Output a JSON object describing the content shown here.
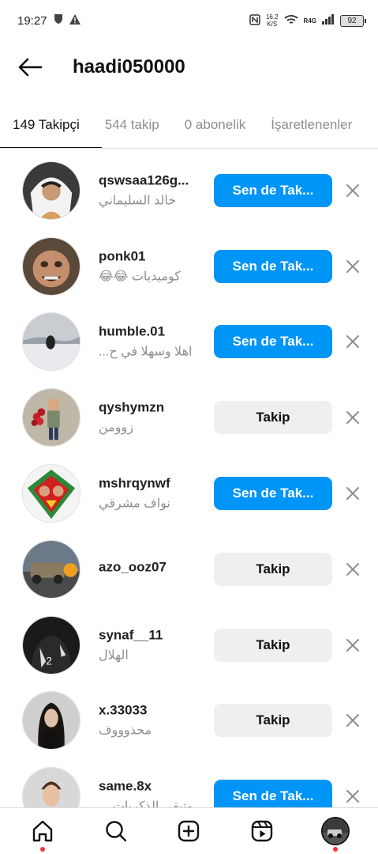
{
  "status_bar": {
    "time": "19:27",
    "net_speed_value": "16,2",
    "net_speed_unit": "K/S",
    "network": "R4G",
    "battery": "92"
  },
  "header": {
    "title": "haadi050000"
  },
  "tabs": [
    {
      "label": "149 Takipçi",
      "active": true
    },
    {
      "label": "544 takip",
      "active": false
    },
    {
      "label": "0 abonelik",
      "active": false
    },
    {
      "label": "İşaretlenenler",
      "active": false
    }
  ],
  "followers": [
    {
      "handle": "qswsaa126g...",
      "name": "خالد السليماني",
      "button": "Sen de Tak...",
      "style": "primary"
    },
    {
      "handle": "ponk01",
      "name": "كوميديات 😂😂",
      "button": "Sen de Tak...",
      "style": "primary"
    },
    {
      "handle": "humble.01",
      "name": "اهلا وسهلا في ح...",
      "button": "Sen de Tak...",
      "style": "primary"
    },
    {
      "handle": "qyshymzn",
      "name": "زوومن",
      "button": "Takip",
      "style": "secondary"
    },
    {
      "handle": "mshrqynwf",
      "name": "نواف مشرقي",
      "button": "Sen de Tak...",
      "style": "primary"
    },
    {
      "handle": "azo_ooz07",
      "name": "",
      "button": "Takip",
      "style": "secondary"
    },
    {
      "handle": "synaf__11",
      "name": "الهلال",
      "button": "Takip",
      "style": "secondary"
    },
    {
      "handle": "x.33033",
      "name": "محذوووف",
      "button": "Takip",
      "style": "secondary"
    },
    {
      "handle": "same.8x",
      "name": "وتبقى الذكريات ...",
      "button": "Sen de Tak...",
      "style": "primary"
    }
  ],
  "icons": {
    "back": "arrow-left-icon",
    "remove": "close-icon",
    "nav": [
      "home-icon",
      "search-icon",
      "create-icon",
      "reels-icon",
      "profile-avatar"
    ]
  },
  "colors": {
    "primary_button": "#0095f6",
    "secondary_button": "#efefef",
    "notification_dot": "#ff3040"
  }
}
